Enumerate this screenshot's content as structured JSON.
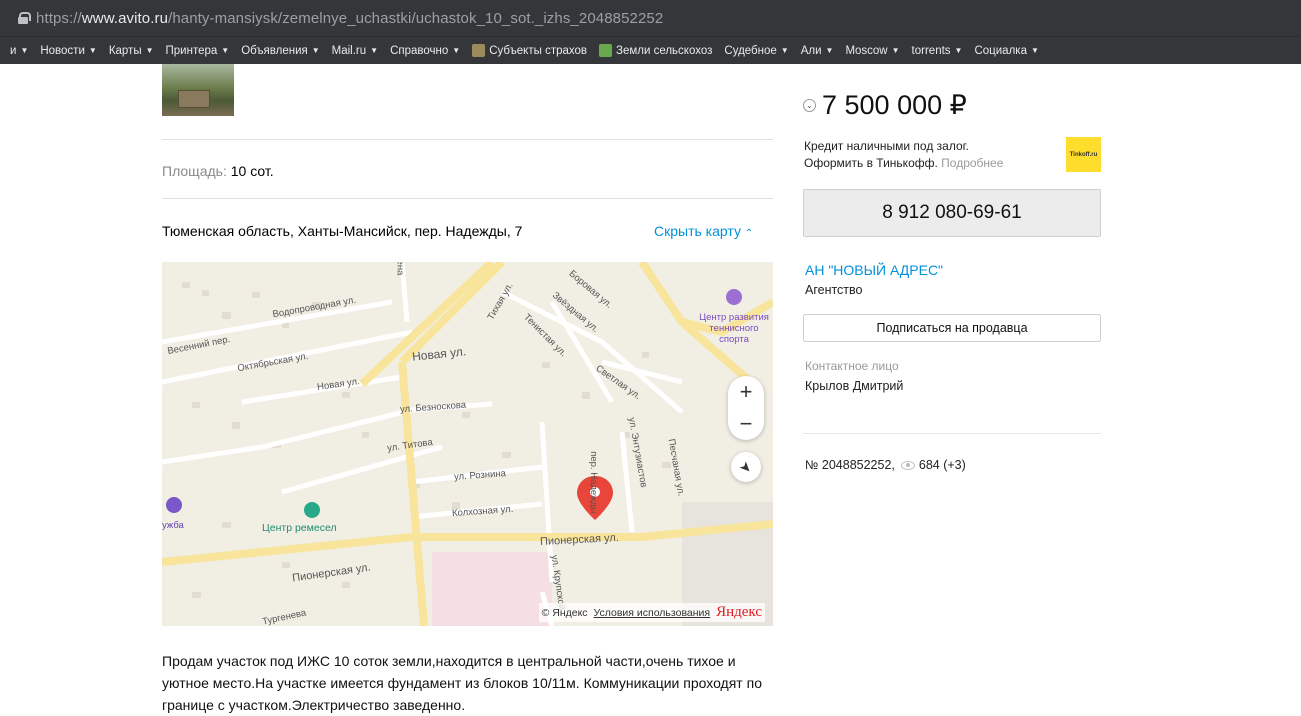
{
  "browser": {
    "url_prefix": "https://",
    "url_host": "www.avito.ru",
    "url_path": "/hanty-mansiysk/zemelnye_uchastki/uchastok_10_sot._izhs_2048852252",
    "bookmarks": [
      {
        "label": "и",
        "dropdown": true
      },
      {
        "label": "Новости",
        "dropdown": true
      },
      {
        "label": "Карты",
        "dropdown": true
      },
      {
        "label": "Принтера",
        "dropdown": true
      },
      {
        "label": "Объявления",
        "dropdown": true
      },
      {
        "label": "Mail.ru",
        "dropdown": true
      },
      {
        "label": "Справочно",
        "dropdown": true
      },
      {
        "label": "Субъекты страхов",
        "dropdown": false,
        "icon": "emblem-icon"
      },
      {
        "label": "Земли сельскохоз",
        "dropdown": false,
        "icon": "leaf-icon"
      },
      {
        "label": "Судебное",
        "dropdown": true
      },
      {
        "label": "Али",
        "dropdown": true
      },
      {
        "label": "Moscow",
        "dropdown": true
      },
      {
        "label": "torrents",
        "dropdown": true
      },
      {
        "label": "Социалка",
        "dropdown": true
      }
    ]
  },
  "listing": {
    "area_label": "Площадь:",
    "area_value": "10 сот.",
    "address": "Тюменская область, Ханты-Мансийск, пер. Надежды, 7",
    "hide_map": "Скрыть карту",
    "description": "Продам участок под ИЖС 10 соток земли,находится в центральной части,очень тихое и уютное место.На участке имеется фундамент из блоков 10/11м. Коммуникации проходят по границе с участком.Электричество заведенно."
  },
  "map": {
    "labels": {
      "vodoprovodnaya": "Водопроводная ул.",
      "vesenniy": "Весенний пер.",
      "oktyabrskaya": "Октябрьская ул.",
      "novaya_main": "Новая ул.",
      "novaya_small": "Новая ул.",
      "tikhaya": "Тихая ул.",
      "borovaya": "Боровая ул.",
      "zvezdnaya": "Звёздная ул.",
      "tenistaya": "Тенистая ул.",
      "svetlaya": "Светлая ул.",
      "bezноскова": "ул. Безноскова",
      "titova": "ул. Титова",
      "roznina": "ул. Рознина",
      "kolkhoznaya": "Колхозная ул.",
      "pionerskaya_right": "Пионерская ул.",
      "pionerskaya_left": "Пионерская ул.",
      "entuziastov": "ул. Энтузиастов",
      "peschanaya": "Песчаная ул.",
      "krupskoy": "ул. Крупской",
      "turgeneva": "Тургенева",
      "per_nadezhdy": "пер. Надежды",
      "tennis_center": "Центр развития теннисного спорта",
      "remesel_center": "Центр ремесел",
      "druzhba": "ужба",
      "top_street": "ена"
    },
    "zoom_in": "+",
    "zoom_out": "−",
    "copyright": "© Яндекс",
    "terms": "Условия использования",
    "logo": "Яндекс"
  },
  "sidebar": {
    "price": "7 500 000 ₽",
    "credit_line1": "Кредит наличными под залог.",
    "credit_line2": "Оформить в Тинькофф.",
    "credit_more": "Подробнее",
    "tinkoff_logo": "Tinkoff.ru",
    "phone": "8 912 080-69-61",
    "seller_name": "АН \"НОВЫЙ АДРЕС\"",
    "seller_type": "Агентство",
    "subscribe": "Подписаться на продавца",
    "contact_label": "Контактное лицо",
    "contact_name": "Крылов Дмитрий",
    "ad_number": "№ 2048852252,",
    "views": "684 (+3)"
  },
  "colors": {
    "link_blue": "#0091d9",
    "chrome_bg": "#35363a",
    "pin_red": "#e8463b",
    "tinkoff_yellow": "#ffdd2d"
  }
}
